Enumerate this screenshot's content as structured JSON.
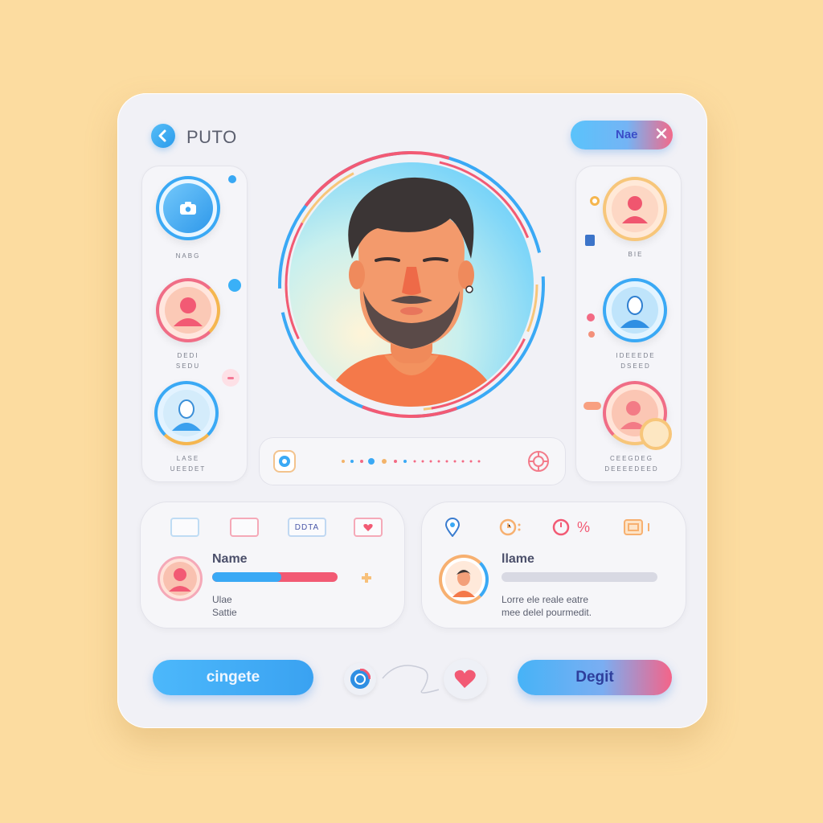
{
  "header": {
    "title": "PUTO",
    "back_icon": "chevron-left-icon",
    "pill_label": "Nae",
    "pill_icon": "close-icon"
  },
  "left_column": {
    "items": [
      {
        "caption": "NABG",
        "icon": "camera-icon"
      },
      {
        "caption": "DEDI\nSEDU",
        "icon": "user-icon"
      },
      {
        "caption": "LASE\nUEEDET",
        "icon": "user-icon"
      }
    ]
  },
  "right_column": {
    "items": [
      {
        "caption": "BIE",
        "icon": "user-icon"
      },
      {
        "caption": "IDEEEDE\nDSEED",
        "icon": "user-icon"
      },
      {
        "caption": "CEEGDEG\nDEEEEDEED",
        "icon": "user-icon"
      }
    ]
  },
  "hero": {
    "icon": "profile-avatar-icon"
  },
  "slider": {
    "left_icon": "target-icon",
    "right_icon": "settings-icon"
  },
  "info_left": {
    "tags": [
      "",
      "",
      "DDTA",
      ""
    ],
    "heading": "Name",
    "line1": "Ulae",
    "line2": "Sattie",
    "progress": 0.55
  },
  "info_right": {
    "icons": [
      "location-pin-icon",
      "clock-icon",
      "percent-icon",
      "card-icon"
    ],
    "percent_text": "%",
    "heading": "llame",
    "text_line1": "Lorre ele reale eatre",
    "text_line2": "mee delel pourmedit."
  },
  "footer": {
    "left_button": "cingete",
    "right_button": "Degit",
    "center_icons": [
      "target-icon",
      "heart-icon"
    ]
  },
  "colors": {
    "accent_blue": "#3aa9f5",
    "accent_pink": "#f35b7d",
    "background": "#fcdca0",
    "card": "#f1f1f6"
  }
}
